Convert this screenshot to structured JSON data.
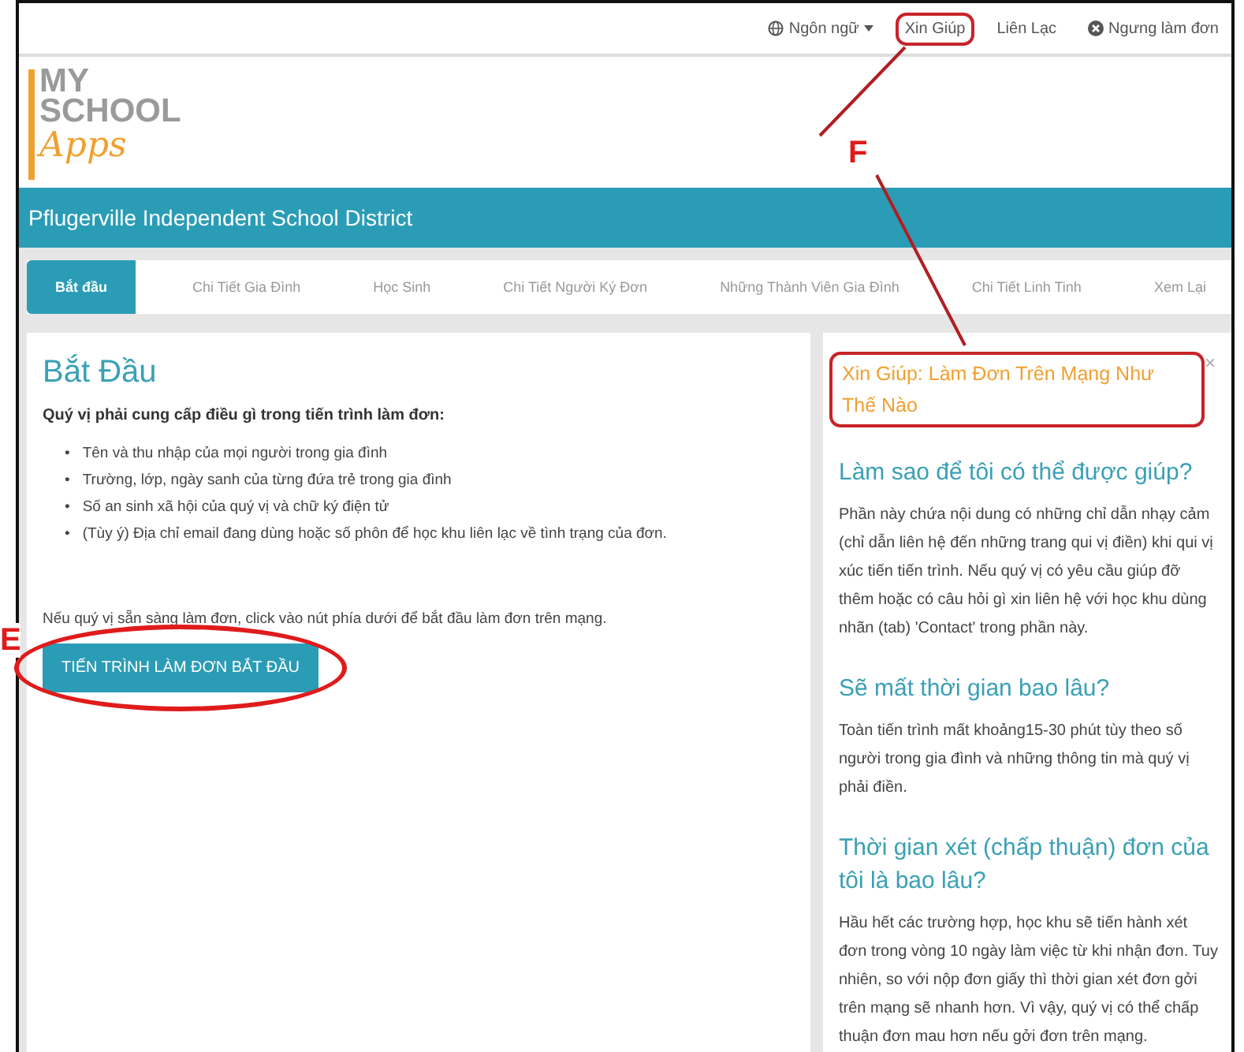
{
  "top_nav": [
    {
      "label": "Ngôn ngữ",
      "kind": "language"
    },
    {
      "label": "Xin Giúp",
      "kind": "link"
    },
    {
      "label": "Liên Lạc",
      "kind": "link"
    },
    {
      "label": "Ngưng làm đơn",
      "kind": "quit"
    }
  ],
  "logo": {
    "line_1": "MY",
    "line_2": "SCHOOL",
    "line_3": "Apps"
  },
  "district": "Pflugerville Independent School District",
  "tabs": [
    {
      "label": "Bắt đầu",
      "selected": true
    },
    {
      "label": "Chi Tiết Gia Đình",
      "selected": false
    },
    {
      "label": "Học Sinh",
      "selected": false
    },
    {
      "label": "Chi Tiết Người Ký Đơn",
      "selected": false
    },
    {
      "label": "Những Thành Viên Gia Đình",
      "selected": false
    },
    {
      "label": "Chi Tiết Linh Tinh",
      "selected": false
    },
    {
      "label": "Xem Lại",
      "selected": false
    }
  ],
  "main": {
    "title": "Bắt Đầu",
    "bullet": "•",
    "subtitle": "Quý vị phải cung cấp điều gì trong tiến trình làm đơn:",
    "items": [
      "Tên và thu nhập của mọi người trong gia đình",
      "Trường, lớp, ngày sanh của từng đứa trẻ trong gia đình",
      "Số an sinh xã hội của quý vị và chữ ký điện tử",
      "(Tùy ý) Địa chỉ email đang dùng hoặc số phôn để học khu liên lạc về tình trạng của đơn."
    ],
    "note": "Nếu quý vị sẵn sàng làm đơn, click vào nút phía dưới để bắt đầu làm đơn trên mạng.",
    "button": "TIẾN TRÌNH LÀM ĐƠN BẮT ĐẦU"
  },
  "help": {
    "title": "Xin Giúp: Làm Đơn Trên Mạng Như Thế Nào",
    "close": "×",
    "sections": [
      {
        "heading": "Làm sao để tôi có thể được giúp?",
        "body": "Phần này chứa nội dung có những chỉ dẫn nhạy cảm (chỉ dẫn liên hệ đến những trang qui vị điền) khi qui vị xúc tiến tiến trình. Nếu quý vị có yêu cầu giúp đỡ thêm hoặc có câu hỏi gì xin liên hệ với học khu dùng nhãn (tab) 'Contact' trong phần này."
      },
      {
        "heading": "Sẽ mất thời gian bao lâu?",
        "body": "Toàn tiến trình mất khoảng15-30 phút tùy theo số người trong gia đình và những thông tin mà quý vị phải điền."
      },
      {
        "heading": "Thời gian xét (chấp thuận) đơn của tôi là bao lâu?",
        "body": "Hầu hết các trường hợp, học khu sẽ tiến hành xét đơn trong vòng 10 ngày làm việc từ khi nhận đơn. Tuy nhiên, so với nộp đơn giấy thì thời gian xét đơn gởi trên mạng sẽ nhanh hơn. Vì vậy, quý vị có thể chấp thuận đơn mau hơn nếu gởi đơn trên mạng."
      }
    ]
  },
  "annotations": [
    {
      "label": "E",
      "kind": "E"
    },
    {
      "label": "F",
      "kind": "F"
    }
  ]
}
